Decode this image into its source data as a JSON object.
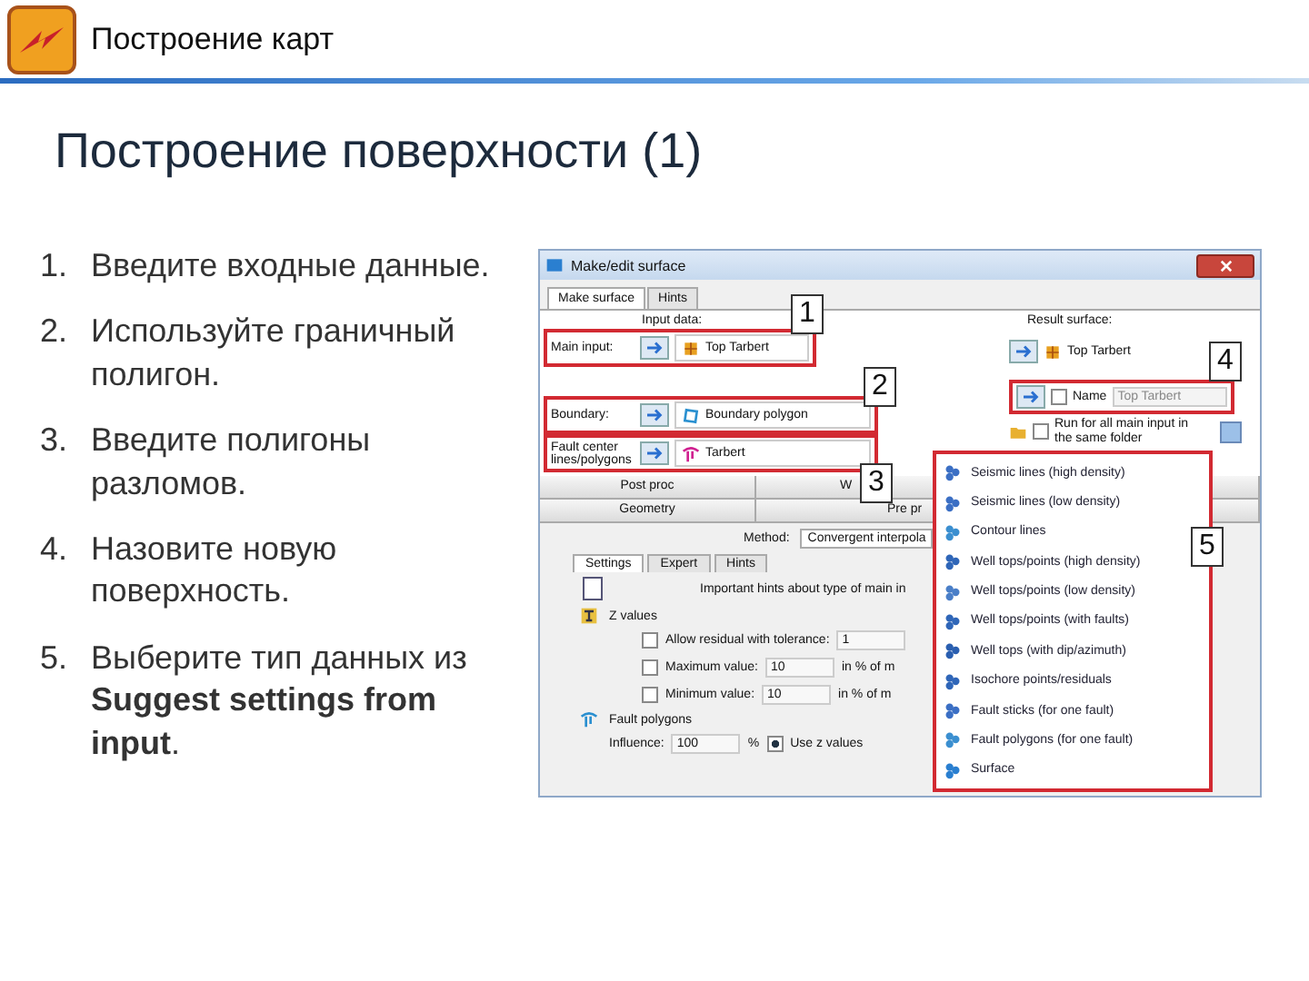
{
  "header": {
    "title": "Построение карт"
  },
  "slide_title": "Построение поверхности (1)",
  "steps": [
    {
      "number": "1.",
      "text": "Введите входные данные."
    },
    {
      "number": "2.",
      "text": "Используйте граничный полигон."
    },
    {
      "number": "3.",
      "text": "Введите полигоны разломов."
    },
    {
      "number": "4.",
      "text": "Назовите новую поверхность."
    },
    {
      "number": "5.",
      "text": "Выберите тип данных из **Suggest settings from input**."
    }
  ],
  "dialog": {
    "title": "Make/edit surface",
    "tabs": [
      {
        "label": "Make surface",
        "selected": true
      },
      {
        "label": "Hints",
        "selected": false
      }
    ],
    "input_label": "Input data:",
    "inputs": [
      {
        "label": "Main input:",
        "value": "Top Tarbert",
        "kind": "surface"
      },
      {
        "label": "Boundary:",
        "value": "Boundary polygon",
        "kind": "polygon"
      },
      {
        "label": "Fault center lines/polygons",
        "value": "Tarbert",
        "kind": "fault"
      }
    ],
    "result_label": "Result surface:",
    "result_value": "Top Tarbert",
    "name": {
      "label": "Name",
      "checked": false,
      "value": "Top Tarbert"
    },
    "run_all": {
      "label": "Run for all main input in the same folder",
      "checked": false
    },
    "process_tabs": [
      [
        "Post proc",
        "W"
      ],
      [
        "Geometry",
        "Pre pr"
      ]
    ],
    "method": {
      "label": "Method:",
      "value": "Convergent interpola"
    },
    "settings_tabs": [
      {
        "label": "Settings",
        "selected": true
      },
      {
        "label": "Expert",
        "selected": false
      },
      {
        "label": "Hints",
        "selected": false
      }
    ],
    "hint": "Important hints about type of main in",
    "z_values": {
      "label": "Z values",
      "rows": [
        {
          "label": "Allow residual with tolerance:",
          "checked": false,
          "value": "1"
        },
        {
          "label": "Maximum value:",
          "checked": false,
          "value": "10",
          "unit": "in % of m"
        },
        {
          "label": "Minimum value:",
          "checked": false,
          "value": "10",
          "unit": "in % of m"
        }
      ]
    },
    "fault_polygons": {
      "label": "Fault polygons",
      "influence_label": "Influence:",
      "influence": "100",
      "unit": "%",
      "use_z": {
        "label": "Use z values",
        "checked": true
      }
    },
    "callouts": [
      "1",
      "2",
      "3",
      "4",
      "5"
    ],
    "data_types": [
      "Seismic lines (high density)",
      "Seismic lines (low density)",
      "Contour lines",
      "Well tops/points (high density)",
      "Well tops/points (low density)",
      "Well tops/points (with faults)",
      "Well tops (with dip/azimuth)",
      "Isochore points/residuals",
      "Fault sticks (for one fault)",
      "Fault polygons (for one fault)",
      "Surface"
    ]
  }
}
